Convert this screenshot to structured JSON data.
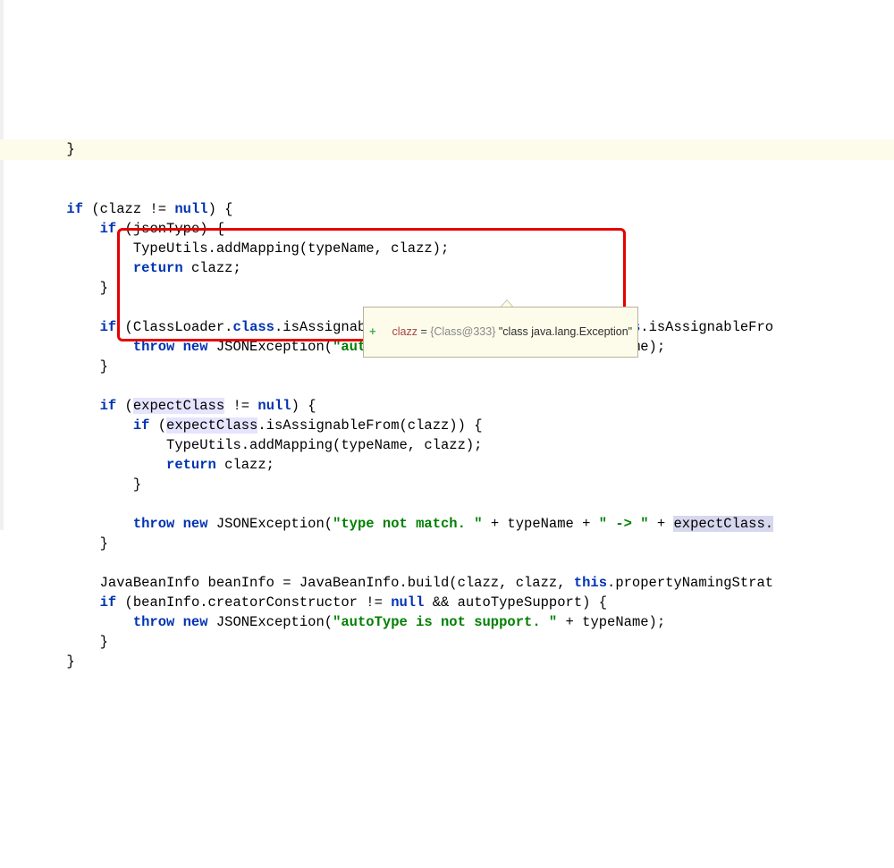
{
  "code": {
    "l0": "        }",
    "l1": "",
    "l2a": "        if",
    "l2b": " (clazz != ",
    "l2c": "null",
    "l2d": ") {",
    "l3a": "            if",
    "l3b": " (jsonType) {",
    "l4": "                TypeUtils.addMapping(typeName, clazz);",
    "l5a": "                return",
    "l5b": " clazz;",
    "l6": "            }",
    "l7": "",
    "l8a": "            if",
    "l8b": " (ClassLoader.",
    "l8c": "class",
    "l8d": ".isAssignableFrom(clazz) || DataSource.",
    "l8e": "class",
    "l8f": ".isAssignableFro",
    "l9a": "                throw new",
    "l9b": " JSONException(",
    "l9c": "\"autoType is not support. \"",
    "l9d": " + typeName);",
    "l10": "            }",
    "l11": "",
    "l12a": "            if",
    "l12b": " (",
    "l12c": "expectClass",
    "l12d": " != ",
    "l12e": "null",
    "l12f": ") {",
    "l13a": "                if",
    "l13b": " (",
    "l13c": "expectClass",
    "l13d": ".isAssignableFrom(clazz)) {",
    "l14": "                    TypeUtils.addMapping(typeName, clazz);",
    "l15a": "                    return",
    "l15b": " clazz;",
    "l16": "                }",
    "l17": "",
    "l18a": "                throw new",
    "l18b": " JSONException(",
    "l18c": "\"type not match. \"",
    "l18d": " + typeName + ",
    "l18e": "\" -> \"",
    "l18f": " + ",
    "l18g": "expectClass.",
    "l19": "            }",
    "l20": "",
    "l21a": "            JavaBeanInfo beanInfo = JavaBeanInfo.build(clazz, clazz, ",
    "l21b": "this",
    "l21c": ".propertyNamingStrat",
    "l22a": "            if",
    "l22b": " (beanInfo.creatorConstructor != ",
    "l22c": "null",
    "l22d": " && autoTypeSupport) {",
    "l23a": "                throw new",
    "l23b": " JSONException(",
    "l23c": "\"autoType is not support. \"",
    "l23d": " + typeName);",
    "l24": "            }",
    "l25": "        }"
  },
  "tooltip": {
    "plus": "+",
    "var": "clazz",
    "eq": " = ",
    "obj": "{Class@333}",
    "sp": " ",
    "val": "\"class java.lang.Exception\""
  }
}
